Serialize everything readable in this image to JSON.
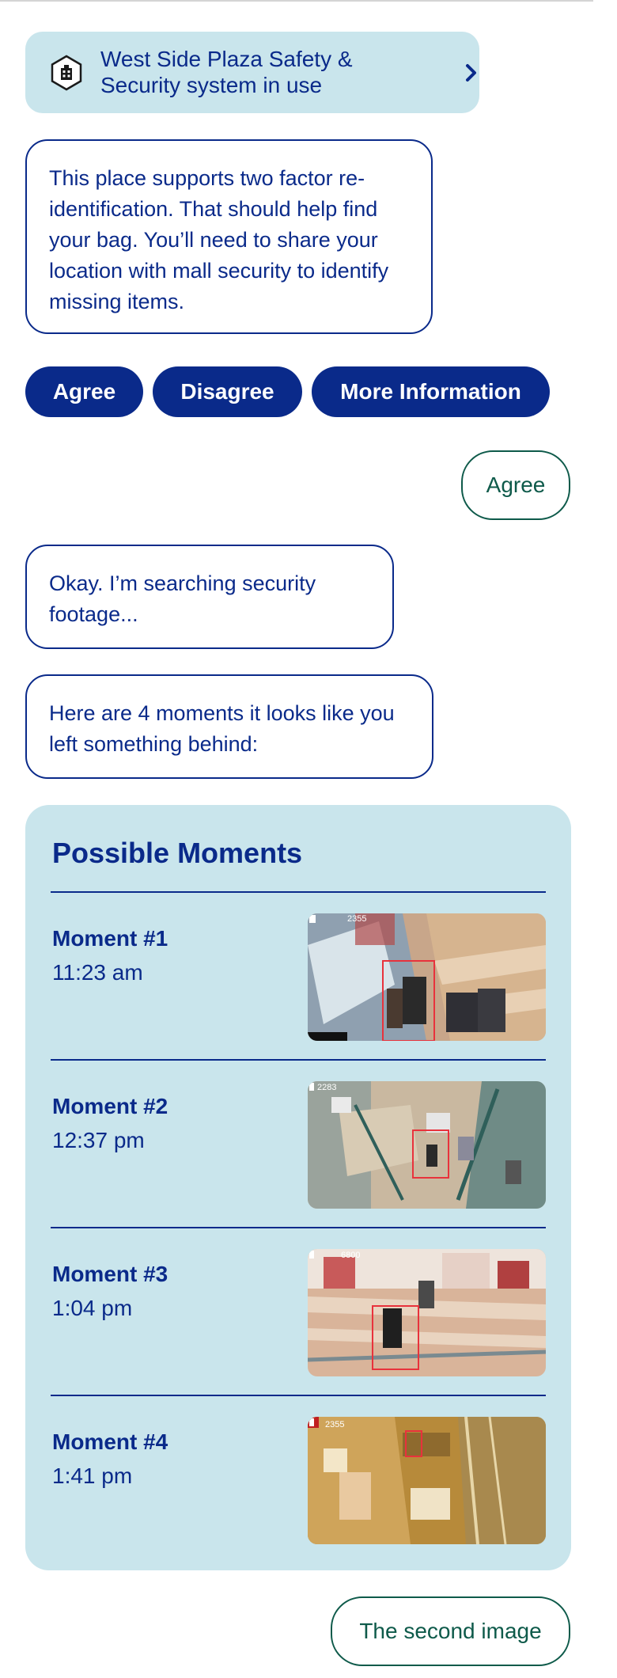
{
  "notice": {
    "text": "West Side Plaza Safety & Security system in use",
    "icon": "building-hexagon-icon"
  },
  "bot_messages": [
    "This place supports two factor re-identification. That should help find your bag. You’ll need to share your location with mall security to identify missing items.",
    "Okay. I’m searching security footage...",
    "Here are 4 moments it looks like you left something behind:"
  ],
  "quick_replies": [
    "Agree",
    "Disagree",
    "More Information"
  ],
  "user_messages": [
    "Agree",
    "The second image"
  ],
  "moments": {
    "title": "Possible Moments",
    "items": [
      {
        "label": "Moment #1",
        "time": "11:23 am",
        "overlay": "2355"
      },
      {
        "label": "Moment #2",
        "time": "12:37 pm",
        "overlay": "2283"
      },
      {
        "label": "Moment #3",
        "time": "1:04 pm",
        "overlay": "6800"
      },
      {
        "label": "Moment #4",
        "time": "1:41 pm",
        "overlay": "2355"
      }
    ]
  },
  "colors": {
    "primary": "#0a2a8a",
    "card_bg": "#c9e5ec",
    "user_outline": "#0e5a4a",
    "detection_box": "#e8323c"
  }
}
